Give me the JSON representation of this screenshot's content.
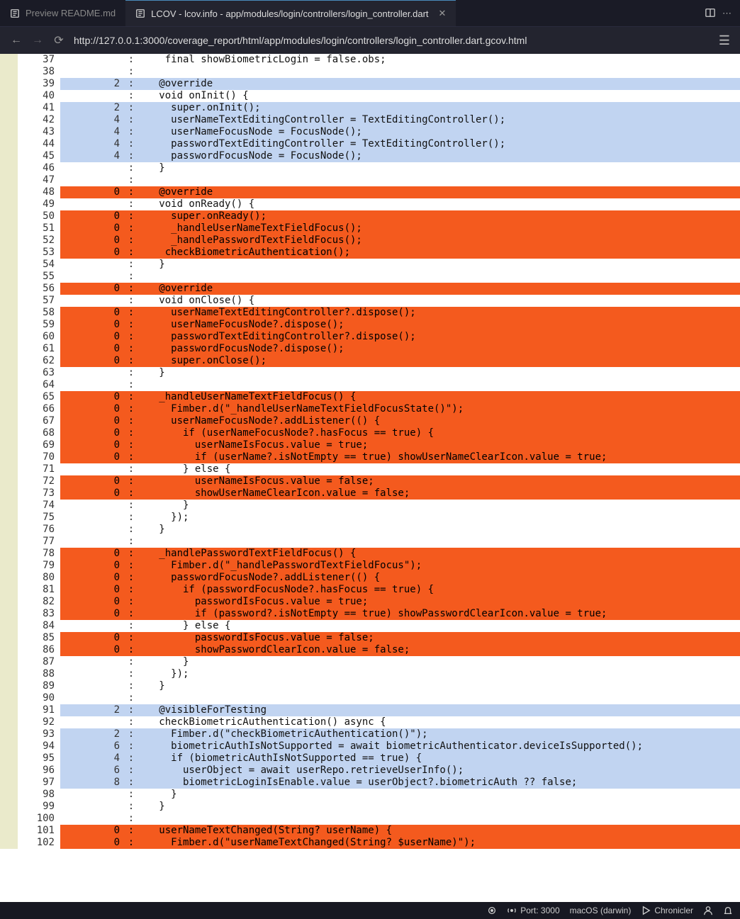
{
  "tabs": {
    "inactive": {
      "label": "Preview README.md"
    },
    "active": {
      "label": "LCOV - lcov.info - app/modules/login/controllers/login_controller.dart"
    }
  },
  "url": "http://127.0.0.1:3000/coverage_report/html/app/modules/login/controllers/login_controller.dart.gcov.html",
  "status": {
    "port": "Port: 3000",
    "os": "macOS (darwin)",
    "chron": "Chronicler"
  },
  "lines": [
    {
      "n": 37,
      "h": "",
      "c": "none",
      "t": "    final showBiometricLogin = false.obs;"
    },
    {
      "n": 38,
      "h": "",
      "c": "none",
      "t": ""
    },
    {
      "n": 39,
      "h": "2",
      "c": "hit",
      "t": "   @override"
    },
    {
      "n": 40,
      "h": "",
      "c": "none",
      "t": "   void onInit() {"
    },
    {
      "n": 41,
      "h": "2",
      "c": "hit",
      "t": "     super.onInit();"
    },
    {
      "n": 42,
      "h": "4",
      "c": "hit",
      "t": "     userNameTextEditingController = TextEditingController();"
    },
    {
      "n": 43,
      "h": "4",
      "c": "hit",
      "t": "     userNameFocusNode = FocusNode();"
    },
    {
      "n": 44,
      "h": "4",
      "c": "hit",
      "t": "     passwordTextEditingController = TextEditingController();"
    },
    {
      "n": 45,
      "h": "4",
      "c": "hit",
      "t": "     passwordFocusNode = FocusNode();"
    },
    {
      "n": 46,
      "h": "",
      "c": "none",
      "t": "   }"
    },
    {
      "n": 47,
      "h": "",
      "c": "none",
      "t": ""
    },
    {
      "n": 48,
      "h": "0",
      "c": "miss",
      "t": "   @override"
    },
    {
      "n": 49,
      "h": "",
      "c": "none",
      "t": "   void onReady() {"
    },
    {
      "n": 50,
      "h": "0",
      "c": "miss",
      "t": "     super.onReady();"
    },
    {
      "n": 51,
      "h": "0",
      "c": "miss",
      "t": "     _handleUserNameTextFieldFocus();"
    },
    {
      "n": 52,
      "h": "0",
      "c": "miss",
      "t": "     _handlePasswordTextFieldFocus();"
    },
    {
      "n": 53,
      "h": "0",
      "c": "miss",
      "t": "    checkBiometricAuthentication();"
    },
    {
      "n": 54,
      "h": "",
      "c": "none",
      "t": "   }"
    },
    {
      "n": 55,
      "h": "",
      "c": "none",
      "t": ""
    },
    {
      "n": 56,
      "h": "0",
      "c": "miss",
      "t": "   @override"
    },
    {
      "n": 57,
      "h": "",
      "c": "none",
      "t": "   void onClose() {"
    },
    {
      "n": 58,
      "h": "0",
      "c": "miss",
      "t": "     userNameTextEditingController?.dispose();"
    },
    {
      "n": 59,
      "h": "0",
      "c": "miss",
      "t": "     userNameFocusNode?.dispose();"
    },
    {
      "n": 60,
      "h": "0",
      "c": "miss",
      "t": "     passwordTextEditingController?.dispose();"
    },
    {
      "n": 61,
      "h": "0",
      "c": "miss",
      "t": "     passwordFocusNode?.dispose();"
    },
    {
      "n": 62,
      "h": "0",
      "c": "miss",
      "t": "     super.onClose();"
    },
    {
      "n": 63,
      "h": "",
      "c": "none",
      "t": "   }"
    },
    {
      "n": 64,
      "h": "",
      "c": "none",
      "t": ""
    },
    {
      "n": 65,
      "h": "0",
      "c": "miss",
      "t": "   _handleUserNameTextFieldFocus() {"
    },
    {
      "n": 66,
      "h": "0",
      "c": "miss",
      "t": "     Fimber.d(\"_handleUserNameTextFieldFocusState()\");"
    },
    {
      "n": 67,
      "h": "0",
      "c": "miss",
      "t": "     userNameFocusNode?.addListener(() {"
    },
    {
      "n": 68,
      "h": "0",
      "c": "miss",
      "t": "       if (userNameFocusNode?.hasFocus == true) {"
    },
    {
      "n": 69,
      "h": "0",
      "c": "miss",
      "t": "         userNameIsFocus.value = true;"
    },
    {
      "n": 70,
      "h": "0",
      "c": "miss",
      "t": "         if (userName?.isNotEmpty == true) showUserNameClearIcon.value = true;"
    },
    {
      "n": 71,
      "h": "",
      "c": "none",
      "t": "       } else {"
    },
    {
      "n": 72,
      "h": "0",
      "c": "miss",
      "t": "         userNameIsFocus.value = false;"
    },
    {
      "n": 73,
      "h": "0",
      "c": "miss",
      "t": "         showUserNameClearIcon.value = false;"
    },
    {
      "n": 74,
      "h": "",
      "c": "none",
      "t": "       }"
    },
    {
      "n": 75,
      "h": "",
      "c": "none",
      "t": "     });"
    },
    {
      "n": 76,
      "h": "",
      "c": "none",
      "t": "   }"
    },
    {
      "n": 77,
      "h": "",
      "c": "none",
      "t": ""
    },
    {
      "n": 78,
      "h": "0",
      "c": "miss",
      "t": "   _handlePasswordTextFieldFocus() {"
    },
    {
      "n": 79,
      "h": "0",
      "c": "miss",
      "t": "     Fimber.d(\"_handlePasswordTextFieldFocus\");"
    },
    {
      "n": 80,
      "h": "0",
      "c": "miss",
      "t": "     passwordFocusNode?.addListener(() {"
    },
    {
      "n": 81,
      "h": "0",
      "c": "miss",
      "t": "       if (passwordFocusNode?.hasFocus == true) {"
    },
    {
      "n": 82,
      "h": "0",
      "c": "miss",
      "t": "         passwordIsFocus.value = true;"
    },
    {
      "n": 83,
      "h": "0",
      "c": "miss",
      "t": "         if (password?.isNotEmpty == true) showPasswordClearIcon.value = true;"
    },
    {
      "n": 84,
      "h": "",
      "c": "none",
      "t": "       } else {"
    },
    {
      "n": 85,
      "h": "0",
      "c": "miss",
      "t": "         passwordIsFocus.value = false;"
    },
    {
      "n": 86,
      "h": "0",
      "c": "miss",
      "t": "         showPasswordClearIcon.value = false;"
    },
    {
      "n": 87,
      "h": "",
      "c": "none",
      "t": "       }"
    },
    {
      "n": 88,
      "h": "",
      "c": "none",
      "t": "     });"
    },
    {
      "n": 89,
      "h": "",
      "c": "none",
      "t": "   }"
    },
    {
      "n": 90,
      "h": "",
      "c": "none",
      "t": ""
    },
    {
      "n": 91,
      "h": "2",
      "c": "hit",
      "t": "   @visibleForTesting"
    },
    {
      "n": 92,
      "h": "",
      "c": "none",
      "t": "   checkBiometricAuthentication() async {"
    },
    {
      "n": 93,
      "h": "2",
      "c": "hit",
      "t": "     Fimber.d(\"checkBiometricAuthentication()\");"
    },
    {
      "n": 94,
      "h": "6",
      "c": "hit",
      "t": "     biometricAuthIsNotSupported = await biometricAuthenticator.deviceIsSupported();"
    },
    {
      "n": 95,
      "h": "4",
      "c": "hit",
      "t": "     if (biometricAuthIsNotSupported == true) {"
    },
    {
      "n": 96,
      "h": "6",
      "c": "hit",
      "t": "       userObject = await userRepo.retrieveUserInfo();"
    },
    {
      "n": 97,
      "h": "8",
      "c": "hit",
      "t": "       biometricLoginIsEnable.value = userObject?.biometricAuth ?? false;"
    },
    {
      "n": 98,
      "h": "",
      "c": "none",
      "t": "     }"
    },
    {
      "n": 99,
      "h": "",
      "c": "none",
      "t": "   }"
    },
    {
      "n": 100,
      "h": "",
      "c": "none",
      "t": ""
    },
    {
      "n": 101,
      "h": "0",
      "c": "miss",
      "t": "   userNameTextChanged(String? userName) {"
    },
    {
      "n": 102,
      "h": "0",
      "c": "miss",
      "t": "     Fimber.d(\"userNameTextChanged(String? $userName)\");"
    }
  ]
}
